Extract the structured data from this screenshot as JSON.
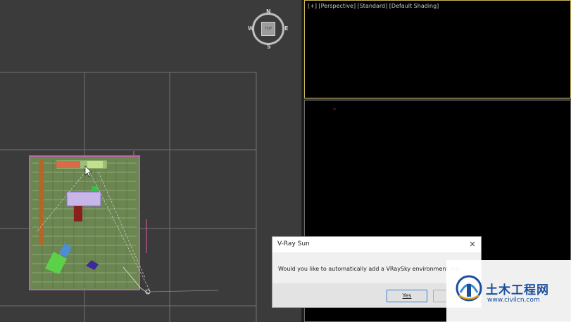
{
  "perspective_viewport": {
    "label": "[+] [Perspective] [Standard] [Default Shading]"
  },
  "viewcube": {
    "north": "N",
    "south": "S",
    "east": "E",
    "west": "W",
    "face": "TOP"
  },
  "dialog": {
    "title": "V-Ray Sun",
    "close_icon": "close-icon",
    "message": "Would you like to automatically add a VRaySky environment ma",
    "yes_label": "Yes",
    "no_label": ""
  },
  "watermark": {
    "title": "土木工程网",
    "url": "www.civilcn.com"
  },
  "colors": {
    "viewport_bg": "#3b3b3b",
    "grid": "#6b6b6b",
    "active_border": "#c8b45a",
    "floor": "#6e8a52",
    "selection": "#b05a9a",
    "watermark_blue": "#1a4f9c"
  }
}
